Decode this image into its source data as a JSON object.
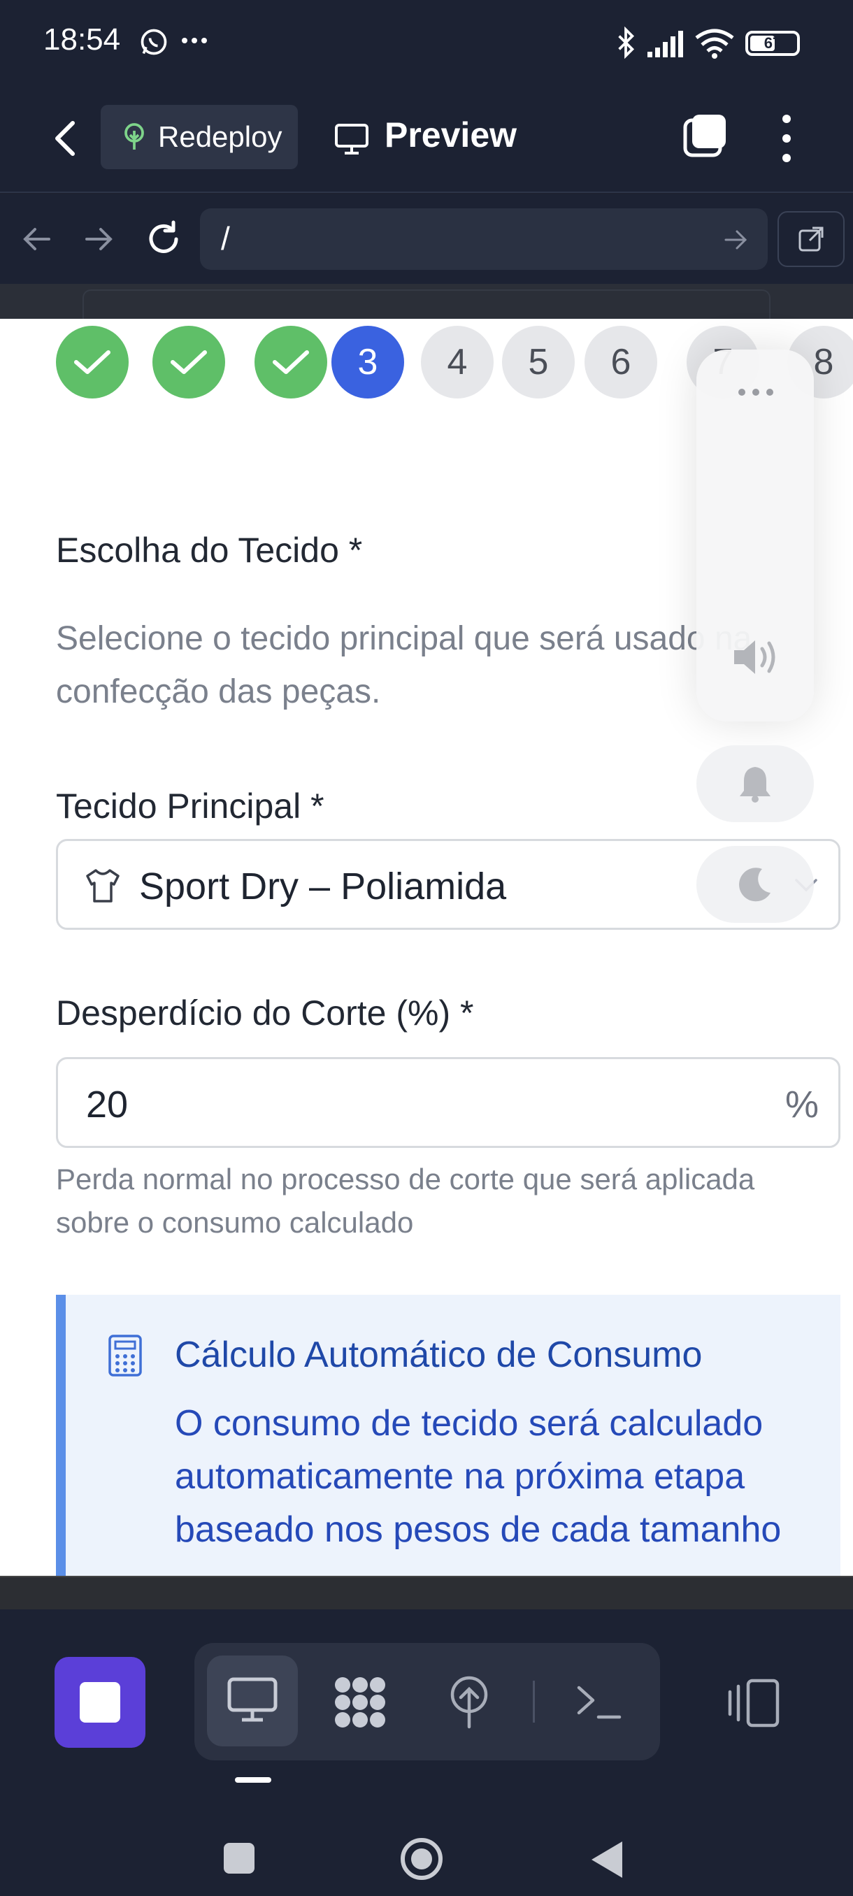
{
  "status_bar": {
    "time": "18:54",
    "battery": "67"
  },
  "app_header": {
    "redeploy_label": "Redeploy",
    "preview_label": "Preview"
  },
  "url_bar": {
    "path": "/"
  },
  "stepper": {
    "steps": [
      {
        "label": "",
        "state": "done"
      },
      {
        "label": "",
        "state": "done"
      },
      {
        "label": "",
        "state": "done"
      },
      {
        "label": "3",
        "state": "current"
      },
      {
        "label": "4",
        "state": "todo"
      },
      {
        "label": "5",
        "state": "todo"
      },
      {
        "label": "6",
        "state": "todo"
      },
      {
        "label": "7",
        "state": "todo"
      },
      {
        "label": "8",
        "state": "todo"
      }
    ]
  },
  "form": {
    "section_title": "Escolha do Tecido *",
    "section_desc": "Selecione o tecido principal que será usado na confecção das peças.",
    "fabric_label": "Tecido Principal *",
    "fabric_value": "Sport Dry – Poliamida",
    "waste_label": "Desperdício do Corte (%) *",
    "waste_value": "20",
    "waste_unit": "%",
    "waste_hint": "Perda normal no processo de corte que será aplicada sobre o consumo calculado"
  },
  "info": {
    "title": "Cálculo Automático de Consumo",
    "body": "O consumo de tecido será calculado automaticamente na próxima etapa baseado nos pesos de cada tamanho"
  },
  "colors": {
    "done": "#5fbf68",
    "current": "#3a62e0",
    "accent_purple": "#5b3fd8",
    "info_blue": "#1f48a8"
  }
}
